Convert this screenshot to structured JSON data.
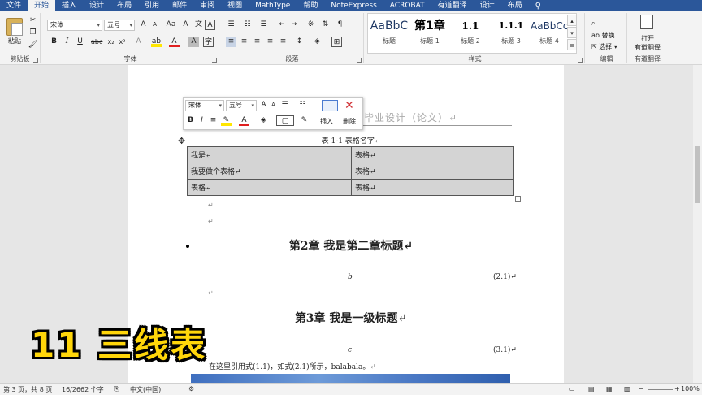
{
  "ribbon_tabs": [
    "文件",
    "开始",
    "插入",
    "设计",
    "布局",
    "引用",
    "邮件",
    "审阅",
    "视图",
    "MathType",
    "帮助",
    "NoteExpress",
    "ACROBAT",
    "有道翻译",
    "设计",
    "布局"
  ],
  "clipboard": {
    "paste_label": "粘贴",
    "group_label": "剪贴板"
  },
  "font": {
    "name": "宋体",
    "size": "五号",
    "group_label": "字体"
  },
  "paragraph": {
    "group_label": "段落"
  },
  "styles": {
    "group_label": "样式",
    "items": [
      {
        "preview": "AaBbC",
        "name": "标题"
      },
      {
        "preview": "第1章",
        "name": "标题 1"
      },
      {
        "preview": "1.1",
        "name": "标题 2"
      },
      {
        "preview": "1.1.1",
        "name": "标题 3"
      },
      {
        "preview": "AaBbCc",
        "name": "标题 4"
      }
    ]
  },
  "editing": {
    "replace_label": "替换",
    "select_label": "选择",
    "group_label": "编辑"
  },
  "youdao": {
    "open_label": "打开",
    "open_sub": "有道翻译",
    "group_label": "有道翻译"
  },
  "mini_toolbar": {
    "font": "宋体",
    "size": "五号",
    "insert_label": "插入",
    "delete_label": "删除"
  },
  "document": {
    "faded_heading": "毕业设计（论文）↵",
    "table_caption": "表 1-1  表格名字↵",
    "table_rows": [
      [
        "我是↵",
        "表格↵"
      ],
      [
        "我要做个表格↵",
        "表格↵"
      ],
      [
        "表格↵",
        "表格↵"
      ]
    ],
    "para_mark": "↵",
    "chapter2_heading": "第2章  我是第二章标题↵",
    "eq1_var": "b",
    "eq1_num": "(2.1)↵",
    "chapter3_heading": "第3章  我是一级标题↵",
    "eq2_var": "c",
    "eq2_num": "(3.1)↵",
    "body_text": "在这里引用式(1.1)，如式(2.1)所示，balabala。↵"
  },
  "overlay_text": "11 三线表",
  "status_bar": {
    "page": "第 3 页，共 8 页",
    "words": "16/2662 个字",
    "language": "中文(中国)",
    "zoom": "100%"
  }
}
